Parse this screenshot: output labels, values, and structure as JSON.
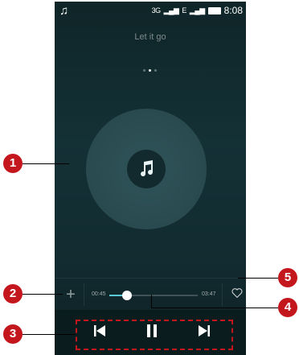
{
  "status": {
    "network_1": "3G",
    "network_2": "E",
    "time": "8:08"
  },
  "song": {
    "title": "Let it go"
  },
  "pager": {
    "count": 3,
    "active_index": 1
  },
  "playback": {
    "elapsed": "00:45",
    "total": "03:47",
    "progress": 0.2
  },
  "callouts": [
    "1",
    "2",
    "3",
    "4",
    "5"
  ],
  "colors": {
    "accent": "#5cc9d6",
    "callout": "#c4171d",
    "background": "#143136"
  },
  "icons": {
    "status_app": "music-note-icon",
    "disc": "music-note-icon",
    "add": "plus-icon",
    "favorite": "heart-outline-icon",
    "previous": "skip-previous-icon",
    "play_pause": "pause-icon",
    "next": "skip-next-icon"
  }
}
